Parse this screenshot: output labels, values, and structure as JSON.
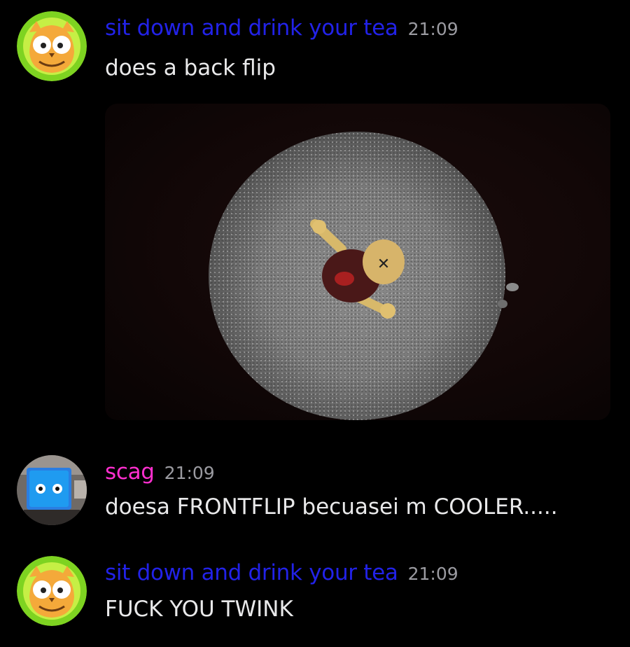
{
  "messages": [
    {
      "author": "sit down and drink your tea",
      "author_color": "#2222e8",
      "time": "21:09",
      "text": "does  a back flip",
      "avatar_icon": "owl-avatar-icon",
      "attachment": "ragdoll-on-gravel-image"
    },
    {
      "author": "scag",
      "author_color": "#ff2fcf",
      "time": "21:09",
      "text": "doesa FRONTFLIP becuasei m COOLER.....",
      "avatar_icon": "blue-monitor-avatar-icon"
    },
    {
      "author": "sit down and drink your tea",
      "author_color": "#2222e8",
      "time": "21:09",
      "text": "FUCK YOU TWINK",
      "avatar_icon": "owl-avatar-icon"
    }
  ]
}
